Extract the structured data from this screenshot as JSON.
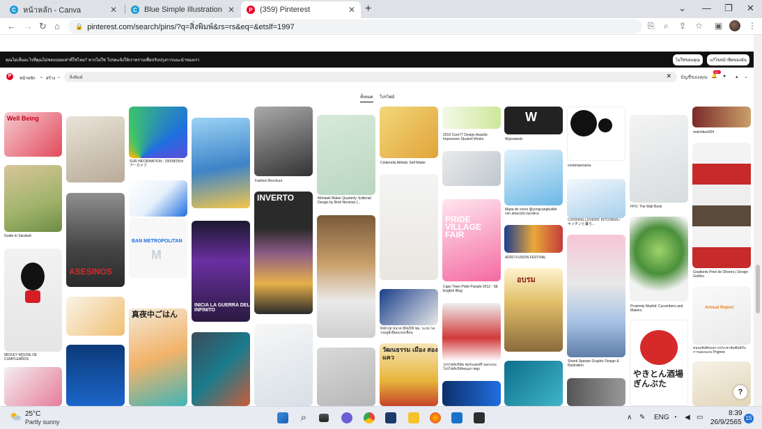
{
  "browser": {
    "tabs": [
      {
        "title": "หน้าหลัก - Canva",
        "close": "✕"
      },
      {
        "title": "Blue Simple Illustration Romance",
        "close": "✕"
      },
      {
        "title": "(359) Pinterest",
        "close": "✕"
      }
    ],
    "new_tab": "+",
    "url": "pinterest.com/search/pins/?q=สิ่งพิมพ์&rs=rs&eq=&etslf=1997"
  },
  "banner": {
    "message": "คุณไม่เห็นอะไรที่คุณไม่ชอบบ่อยเท่าที่ใช่ไหม? หากไม่ใช่ โปรดแจ้งให้เราทราบเพื่อปรับปรุงการแนะนำของเรา",
    "button_no": "ไม่ใช่ขอบคุณ",
    "button_yes": "แก้ไขหน้าฟีดของฉัน"
  },
  "pinterest": {
    "nav_home": "หน้าหลัก",
    "nav_create": "สร้าง",
    "search_value": "สิ่งพิมพ์",
    "filter_all": "ทั้งหมด",
    "filter_profiles": "โปรไฟล์",
    "account_label": "บัญชีของคุณ",
    "notif_count": "99+"
  },
  "pins": {
    "captions": [
      "Guide to Sarabuti",
      "MICKEY MOUSE DE CUMPLEAÑOS",
      "SUR INFORMATION : 2009年05月 アーカイブ",
      "Fashion Brochure",
      "Mohawk Maker Quarterly: Editorial Design by Brett Neuman |...",
      "Cinderella Athletic Self Mailer",
      "Roll Up ขนาด 80x200 ซม. ระบบ โครงอลูมิเนียมแบบเลื่อน",
      "2016 Core77 Design Awards: Impressive Student Works",
      "Cape Town Pride Parade 2012 - SE English Blog",
      "โปรไฟล์บริษัท ฟอร์แมตฟรี ออกแบบ โปรไฟล์บริษัทคุณภาพสูง",
      "Wypowiedz",
      "Mapa de cores @yongcangbuildo con atracción turística",
      "AFRO FUSION FESTIVAL",
      "contemporama",
      "COOKING LOVERS' KITCHENS / キッチンと暮ら...",
      "Shanti Spartan Graphic Design & Illustration",
      "FPO: The Wall Book",
      "Proximity Madrid: Cucumbers and Makers",
      "matchbox004",
      "Gradients Pinel de Oliveira | Design Gráfico",
      "คอนเซ็ปต์ของการประชาสัมพันธ์กับการออกแบบ Pngtree"
    ],
    "overlays": [
      "Well Being",
      "ASESINOS",
      "INVERTO",
      "INICIA LA GUERRA DEL INFINITO",
      "PRIDE VILLAGE FAIR",
      "วัฒนธรรม เมือง สองแคว",
      "やきとん酒場 ぎんぶた",
      "BAN METROPOLITAN",
      "M",
      "真夜中ごはん",
      "อบรม",
      "Annual Report"
    ],
    "help": "?"
  },
  "taskbar": {
    "temperature": "25°C",
    "weather_desc": "Partly sunny",
    "lang": "ENG",
    "time": "8:39",
    "date": "26/9/2565",
    "notifications": "15"
  },
  "colors": {
    "pinterest_red": "#e60023",
    "banner_bg": "#111111",
    "tab_bar": "#dee1e6"
  }
}
